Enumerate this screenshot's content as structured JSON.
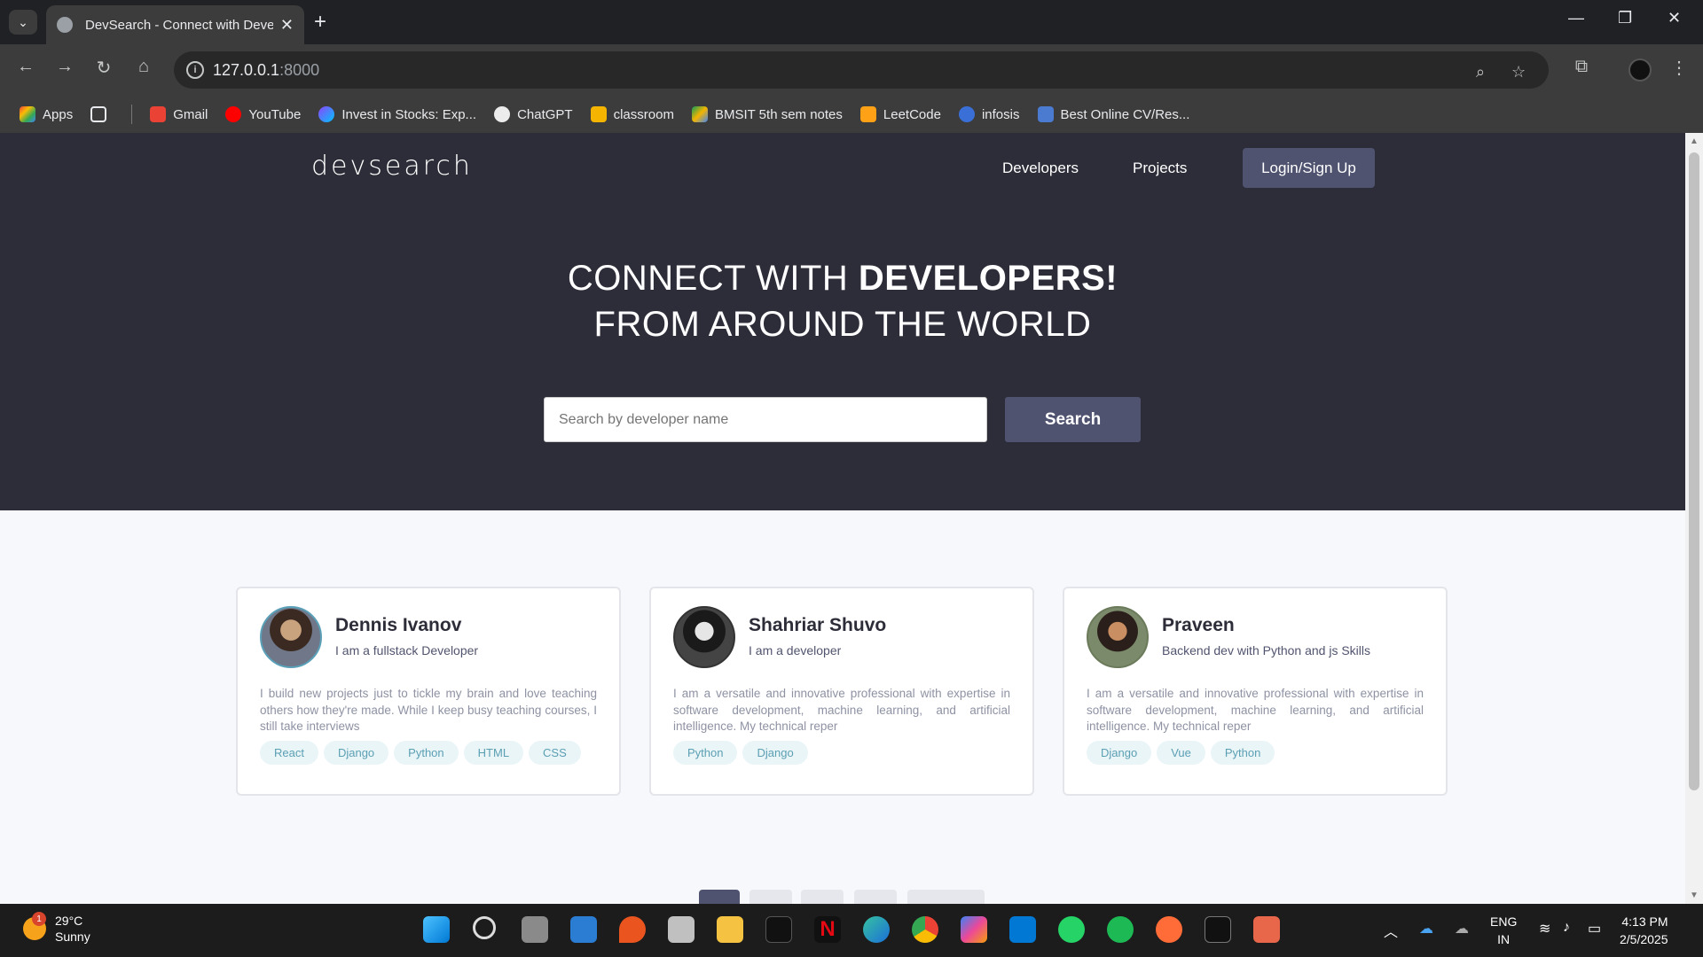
{
  "browser": {
    "tab_title": "DevSearch - Connect with Deve",
    "url_host": "127.0.0.1",
    "url_port": ":8000",
    "bookmarks": [
      "Apps",
      "Gmail",
      "YouTube",
      "Invest in Stocks: Exp...",
      "ChatGPT",
      "classroom",
      "BMSIT 5th sem notes",
      "LeetCode",
      "infosis",
      "Best Online CV/Res..."
    ]
  },
  "site": {
    "logo": "devsearch",
    "nav": {
      "developers": "Developers",
      "projects": "Projects",
      "login": "Login/Sign Up"
    },
    "hero": {
      "line1_normal": "CONNECT WITH ",
      "line1_bold": "DEVELOPERS!",
      "line2": "FROM AROUND THE WORLD"
    },
    "search": {
      "placeholder": "Search by developer name",
      "button": "Search"
    }
  },
  "developers": [
    {
      "name": "Dennis Ivanov",
      "headline": "I am a fullstack Developer",
      "bio": "I build new projects just to tickle my brain and love teaching others how they're made. While I keep busy teaching courses, I still take interviews",
      "tags": [
        "React",
        "Django",
        "Python",
        "HTML",
        "CSS"
      ]
    },
    {
      "name": "Shahriar Shuvo",
      "headline": "I am a developer",
      "bio": "I am a versatile and innovative professional with expertise in software development, machine learning, and artificial intelligence. My technical reper",
      "tags": [
        "Python",
        "Django"
      ]
    },
    {
      "name": "Praveen",
      "headline": "Backend dev with Python and js Skills",
      "bio": "I am a versatile and innovative professional with expertise in software development, machine learning, and artificial intelligence. My technical reper",
      "tags": [
        "Django",
        "Vue",
        "Python"
      ]
    }
  ],
  "taskbar": {
    "weather_temp": "29°C",
    "weather_desc": "Sunny",
    "weather_badge": "1",
    "lang_top": "ENG",
    "lang_bottom": "IN",
    "time": "4:13 PM",
    "date": "2/5/2025"
  }
}
